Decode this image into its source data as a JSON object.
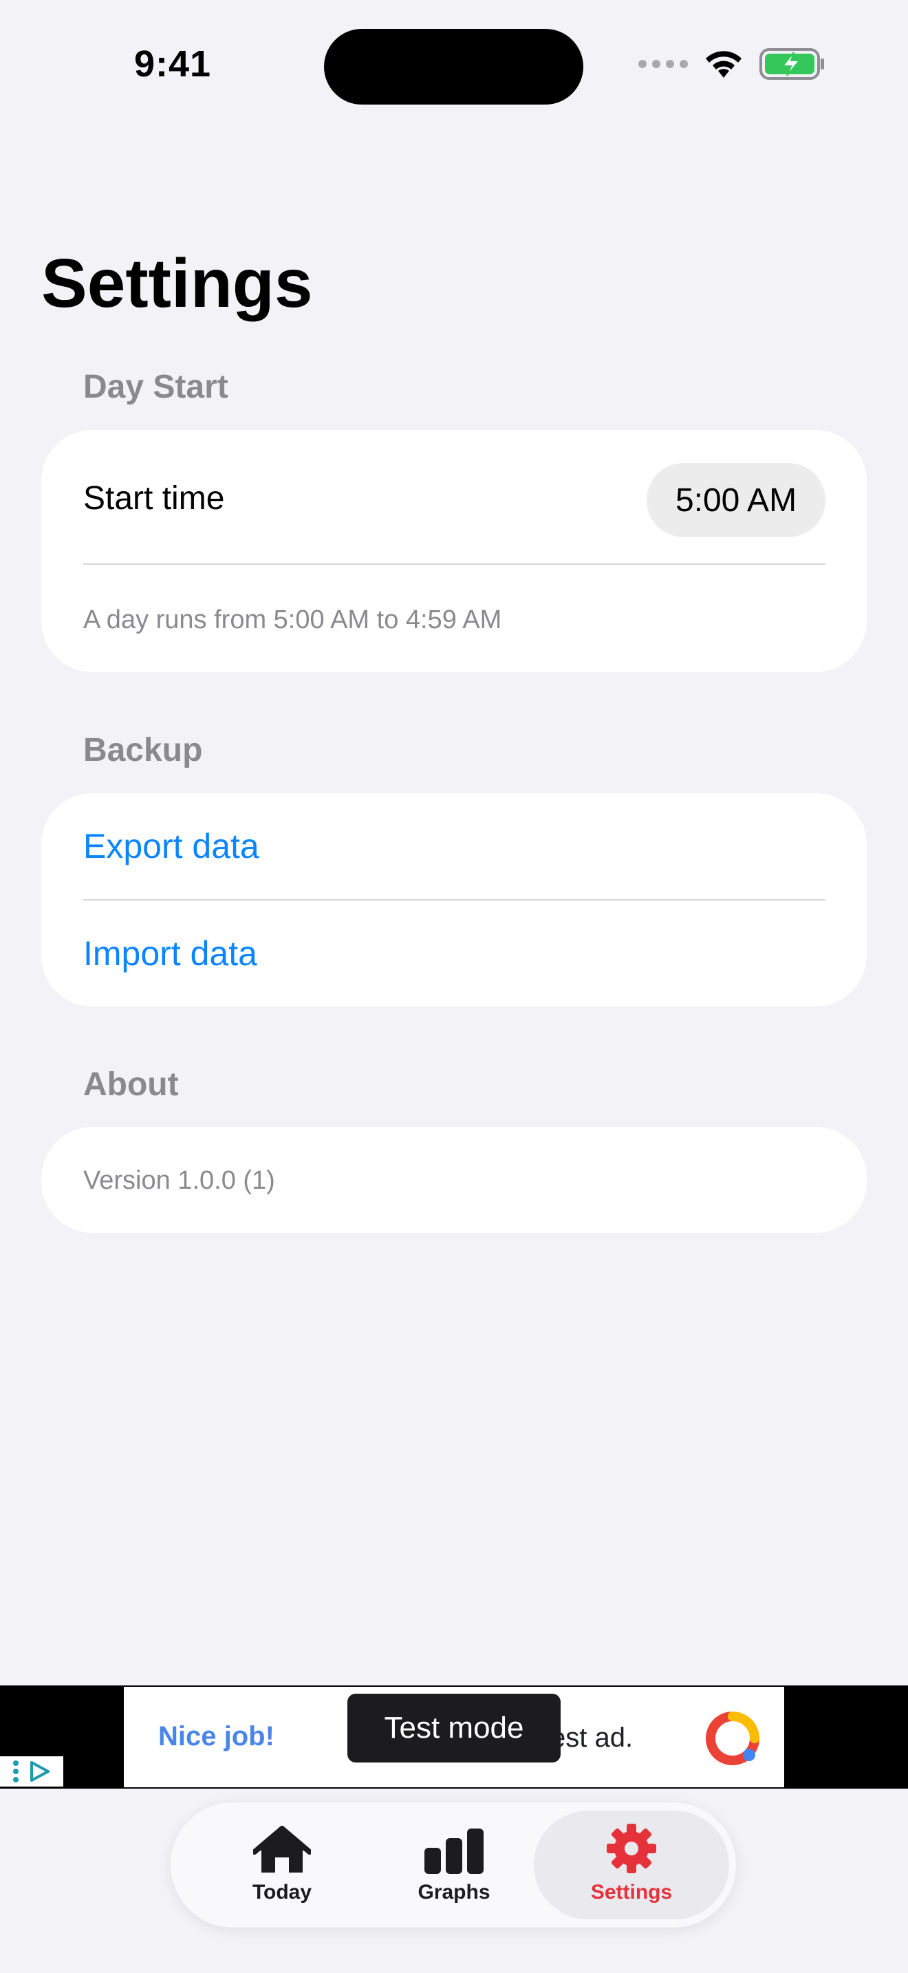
{
  "status_bar": {
    "time": "9:41"
  },
  "page": {
    "title": "Settings"
  },
  "sections": {
    "day_start": {
      "header": "Day Start",
      "start_time_label": "Start time",
      "start_time_value": "5:00 AM",
      "footnote": "A day runs from 5:00 AM to 4:59 AM"
    },
    "backup": {
      "header": "Backup",
      "export_label": "Export data",
      "import_label": "Import data"
    },
    "about": {
      "header": "About",
      "version": "Version 1.0.0 (1)"
    }
  },
  "ad": {
    "headline": "Nice job!",
    "body_fragment": "est ad.",
    "test_mode_label": "Test mode"
  },
  "tab_bar": {
    "tabs": [
      {
        "label": "Today",
        "icon": "house-icon",
        "selected": false
      },
      {
        "label": "Graphs",
        "icon": "bar-chart-icon",
        "selected": false
      },
      {
        "label": "Settings",
        "icon": "gear-icon",
        "selected": true
      }
    ]
  },
  "colors": {
    "background": "#f2f2f7",
    "link": "#0a84ff",
    "accent_selected": "#e5323a",
    "secondary_text": "#8a8a8e",
    "battery_green": "#34c759"
  }
}
